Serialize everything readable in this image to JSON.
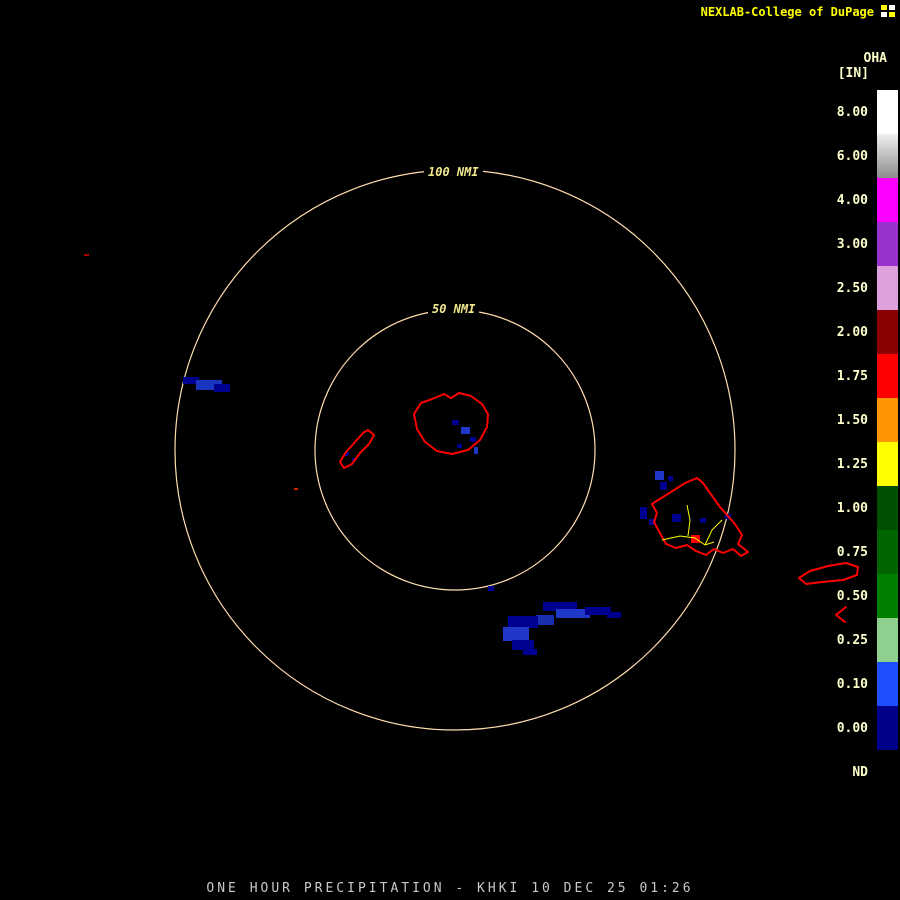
{
  "header": {
    "brand": "NEXLAB-College of DuPage"
  },
  "legend": {
    "product_code": "OHA",
    "units": "[IN]",
    "entries": [
      {
        "label": "8.00",
        "color": "#ffffff"
      },
      {
        "label": "6.00",
        "color": "#f0f0f0",
        "gradient_to": "#8c8c8c"
      },
      {
        "label": "4.00",
        "color": "#ff00ff"
      },
      {
        "label": "3.00",
        "color": "#9932cc"
      },
      {
        "label": "2.50",
        "color": "#dda0dd"
      },
      {
        "label": "2.00",
        "color": "#8b0000"
      },
      {
        "label": "1.75",
        "color": "#ff0000"
      },
      {
        "label": "1.50",
        "color": "#ff9500"
      },
      {
        "label": "1.25",
        "color": "#ffff00"
      },
      {
        "label": "1.00",
        "color": "#004f00"
      },
      {
        "label": "0.75",
        "color": "#006400"
      },
      {
        "label": "0.50",
        "color": "#008000"
      },
      {
        "label": "0.25",
        "color": "#8fd08f"
      },
      {
        "label": "0.10",
        "color": "#1e4fff"
      },
      {
        "label": "0.00",
        "color": "#00008b"
      },
      {
        "label": "ND",
        "color": "#000000"
      }
    ]
  },
  "map": {
    "rings": [
      {
        "label": "100 NMI"
      },
      {
        "label": "50 NMI"
      }
    ],
    "colors": {
      "ring": "#ffdead",
      "coastline": "#ff0000",
      "roads": "#ffff00",
      "echo_light": "#2038c8",
      "echo_dark": "#000090"
    }
  },
  "footer": {
    "title": "ONE HOUR PRECIPITATION - KHKI 10 DEC 25 01:26"
  }
}
